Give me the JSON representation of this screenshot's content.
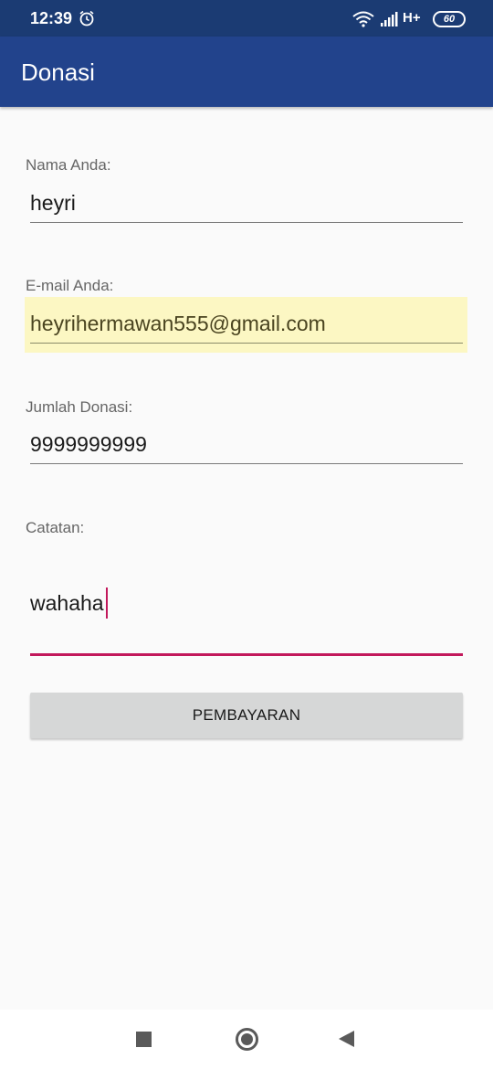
{
  "status_bar": {
    "time": "12:39",
    "network_type": "H+",
    "battery_level": "60",
    "icons": [
      "alarm-icon",
      "wifi-icon",
      "signal-icon",
      "battery-icon"
    ]
  },
  "app_bar": {
    "title": "Donasi"
  },
  "form": {
    "name": {
      "label": "Nama Anda:",
      "value": "heyri"
    },
    "email": {
      "label": "E-mail Anda:",
      "value": "heyrihermawan555@gmail.com"
    },
    "amount": {
      "label": "Jumlah Donasi:",
      "value": "9999999999"
    },
    "notes": {
      "label": "Catatan:",
      "value": "wahaha"
    },
    "submit_label": "PEMBAYARAN"
  },
  "nav_bar": {
    "icons": [
      "recents-icon",
      "home-icon",
      "back-icon"
    ]
  },
  "colors": {
    "status_bar": "#1b3b73",
    "app_bar": "#22438c",
    "accent": "#c2185b",
    "autofill": "#fcf7c3",
    "button": "#d6d7d7"
  }
}
